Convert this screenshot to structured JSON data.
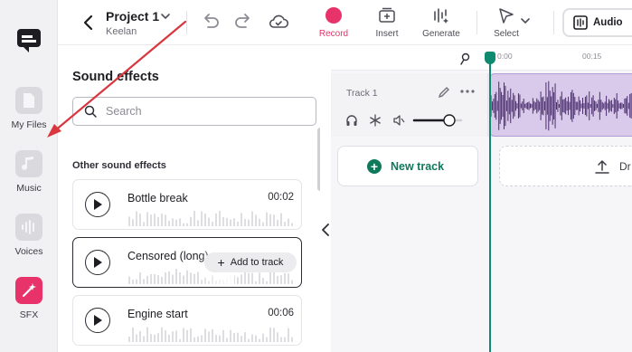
{
  "rail": {
    "items": [
      {
        "label": "My Files",
        "icon": "file-icon"
      },
      {
        "label": "Music",
        "icon": "music-note-icon"
      },
      {
        "label": "Voices",
        "icon": "waveform-icon"
      },
      {
        "label": "SFX",
        "icon": "magic-wand-icon"
      }
    ]
  },
  "topbar": {
    "project_title": "Project 1",
    "project_owner": "Keelan",
    "tools": {
      "record": "Record",
      "insert": "Insert",
      "generate": "Generate",
      "select": "Select"
    },
    "audio_button": "Audio"
  },
  "panel": {
    "title": "Sound effects",
    "search_placeholder": "Search",
    "section_label": "Other sound effects",
    "items": [
      {
        "title": "Bottle break",
        "duration": "00:02"
      },
      {
        "title": "Censored (long)",
        "add_label": "Add to track"
      },
      {
        "title": "Engine start",
        "duration": "00:06"
      }
    ]
  },
  "timeline": {
    "ruler_ticks": [
      "0:00",
      "00:15"
    ],
    "track_name": "Track 1",
    "volume_level": 0.75,
    "new_track_label": "New track",
    "drop_label": "Dr"
  },
  "colors": {
    "accent_pink": "#e8336a",
    "accent_green": "#0e7a5b",
    "clip_purple": "#d9c9ea",
    "waveform_purple": "#4b2e6e",
    "annotation_red": "#d9363e"
  }
}
